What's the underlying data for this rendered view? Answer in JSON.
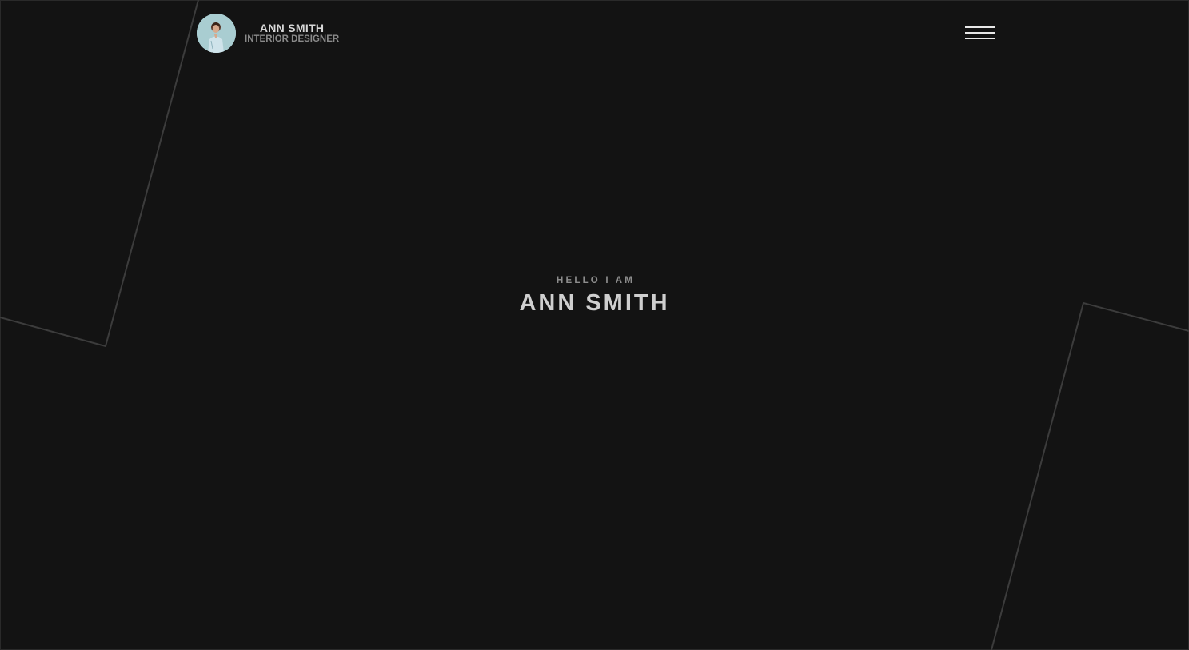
{
  "header": {
    "name": "ANN SMITH",
    "role": "INTERIOR DESIGNER",
    "avatar_alt": "Ann Smith portrait",
    "menu_icon": "hamburger-menu-icon"
  },
  "hero": {
    "kicker": "HELLO I AM",
    "title": "ANN SMITH"
  },
  "colors": {
    "background": "#131313",
    "line": "#3c3c3c",
    "text_primary": "#cfcfcf",
    "text_secondary": "#8d8d8d",
    "menu": "#e8e8e8"
  }
}
